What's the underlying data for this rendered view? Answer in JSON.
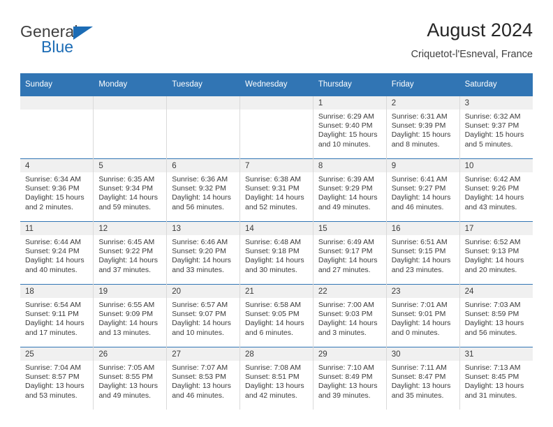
{
  "brand": {
    "word_top": "General",
    "word_bottom": "Blue",
    "accent_color": "#1c6cb5"
  },
  "header": {
    "title": "August 2024",
    "subtitle": "Criquetot-l'Esneval, France"
  },
  "theme": {
    "header_blue": "#3175B4",
    "daynum_gray": "#f0f0f0",
    "text": "#3a3a3a"
  },
  "calendar": {
    "weekday_headers": [
      "Sunday",
      "Monday",
      "Tuesday",
      "Wednesday",
      "Thursday",
      "Friday",
      "Saturday"
    ],
    "labels": {
      "sunrise": "Sunrise:",
      "sunset": "Sunset:",
      "daylight": "Daylight:"
    },
    "weeks": [
      [
        {
          "day": "",
          "blank": true
        },
        {
          "day": "",
          "blank": true
        },
        {
          "day": "",
          "blank": true
        },
        {
          "day": "",
          "blank": true
        },
        {
          "day": "1",
          "sunrise": "Sunrise: 6:29 AM",
          "sunset": "Sunset: 9:40 PM",
          "daylight1": "Daylight: 15 hours",
          "daylight2": "and 10 minutes."
        },
        {
          "day": "2",
          "sunrise": "Sunrise: 6:31 AM",
          "sunset": "Sunset: 9:39 PM",
          "daylight1": "Daylight: 15 hours",
          "daylight2": "and 8 minutes."
        },
        {
          "day": "3",
          "sunrise": "Sunrise: 6:32 AM",
          "sunset": "Sunset: 9:37 PM",
          "daylight1": "Daylight: 15 hours",
          "daylight2": "and 5 minutes."
        }
      ],
      [
        {
          "day": "4",
          "sunrise": "Sunrise: 6:34 AM",
          "sunset": "Sunset: 9:36 PM",
          "daylight1": "Daylight: 15 hours",
          "daylight2": "and 2 minutes."
        },
        {
          "day": "5",
          "sunrise": "Sunrise: 6:35 AM",
          "sunset": "Sunset: 9:34 PM",
          "daylight1": "Daylight: 14 hours",
          "daylight2": "and 59 minutes."
        },
        {
          "day": "6",
          "sunrise": "Sunrise: 6:36 AM",
          "sunset": "Sunset: 9:32 PM",
          "daylight1": "Daylight: 14 hours",
          "daylight2": "and 56 minutes."
        },
        {
          "day": "7",
          "sunrise": "Sunrise: 6:38 AM",
          "sunset": "Sunset: 9:31 PM",
          "daylight1": "Daylight: 14 hours",
          "daylight2": "and 52 minutes."
        },
        {
          "day": "8",
          "sunrise": "Sunrise: 6:39 AM",
          "sunset": "Sunset: 9:29 PM",
          "daylight1": "Daylight: 14 hours",
          "daylight2": "and 49 minutes."
        },
        {
          "day": "9",
          "sunrise": "Sunrise: 6:41 AM",
          "sunset": "Sunset: 9:27 PM",
          "daylight1": "Daylight: 14 hours",
          "daylight2": "and 46 minutes."
        },
        {
          "day": "10",
          "sunrise": "Sunrise: 6:42 AM",
          "sunset": "Sunset: 9:26 PM",
          "daylight1": "Daylight: 14 hours",
          "daylight2": "and 43 minutes."
        }
      ],
      [
        {
          "day": "11",
          "sunrise": "Sunrise: 6:44 AM",
          "sunset": "Sunset: 9:24 PM",
          "daylight1": "Daylight: 14 hours",
          "daylight2": "and 40 minutes."
        },
        {
          "day": "12",
          "sunrise": "Sunrise: 6:45 AM",
          "sunset": "Sunset: 9:22 PM",
          "daylight1": "Daylight: 14 hours",
          "daylight2": "and 37 minutes."
        },
        {
          "day": "13",
          "sunrise": "Sunrise: 6:46 AM",
          "sunset": "Sunset: 9:20 PM",
          "daylight1": "Daylight: 14 hours",
          "daylight2": "and 33 minutes."
        },
        {
          "day": "14",
          "sunrise": "Sunrise: 6:48 AM",
          "sunset": "Sunset: 9:18 PM",
          "daylight1": "Daylight: 14 hours",
          "daylight2": "and 30 minutes."
        },
        {
          "day": "15",
          "sunrise": "Sunrise: 6:49 AM",
          "sunset": "Sunset: 9:17 PM",
          "daylight1": "Daylight: 14 hours",
          "daylight2": "and 27 minutes."
        },
        {
          "day": "16",
          "sunrise": "Sunrise: 6:51 AM",
          "sunset": "Sunset: 9:15 PM",
          "daylight1": "Daylight: 14 hours",
          "daylight2": "and 23 minutes."
        },
        {
          "day": "17",
          "sunrise": "Sunrise: 6:52 AM",
          "sunset": "Sunset: 9:13 PM",
          "daylight1": "Daylight: 14 hours",
          "daylight2": "and 20 minutes."
        }
      ],
      [
        {
          "day": "18",
          "sunrise": "Sunrise: 6:54 AM",
          "sunset": "Sunset: 9:11 PM",
          "daylight1": "Daylight: 14 hours",
          "daylight2": "and 17 minutes."
        },
        {
          "day": "19",
          "sunrise": "Sunrise: 6:55 AM",
          "sunset": "Sunset: 9:09 PM",
          "daylight1": "Daylight: 14 hours",
          "daylight2": "and 13 minutes."
        },
        {
          "day": "20",
          "sunrise": "Sunrise: 6:57 AM",
          "sunset": "Sunset: 9:07 PM",
          "daylight1": "Daylight: 14 hours",
          "daylight2": "and 10 minutes."
        },
        {
          "day": "21",
          "sunrise": "Sunrise: 6:58 AM",
          "sunset": "Sunset: 9:05 PM",
          "daylight1": "Daylight: 14 hours",
          "daylight2": "and 6 minutes."
        },
        {
          "day": "22",
          "sunrise": "Sunrise: 7:00 AM",
          "sunset": "Sunset: 9:03 PM",
          "daylight1": "Daylight: 14 hours",
          "daylight2": "and 3 minutes."
        },
        {
          "day": "23",
          "sunrise": "Sunrise: 7:01 AM",
          "sunset": "Sunset: 9:01 PM",
          "daylight1": "Daylight: 14 hours",
          "daylight2": "and 0 minutes."
        },
        {
          "day": "24",
          "sunrise": "Sunrise: 7:03 AM",
          "sunset": "Sunset: 8:59 PM",
          "daylight1": "Daylight: 13 hours",
          "daylight2": "and 56 minutes."
        }
      ],
      [
        {
          "day": "25",
          "sunrise": "Sunrise: 7:04 AM",
          "sunset": "Sunset: 8:57 PM",
          "daylight1": "Daylight: 13 hours",
          "daylight2": "and 53 minutes."
        },
        {
          "day": "26",
          "sunrise": "Sunrise: 7:05 AM",
          "sunset": "Sunset: 8:55 PM",
          "daylight1": "Daylight: 13 hours",
          "daylight2": "and 49 minutes."
        },
        {
          "day": "27",
          "sunrise": "Sunrise: 7:07 AM",
          "sunset": "Sunset: 8:53 PM",
          "daylight1": "Daylight: 13 hours",
          "daylight2": "and 46 minutes."
        },
        {
          "day": "28",
          "sunrise": "Sunrise: 7:08 AM",
          "sunset": "Sunset: 8:51 PM",
          "daylight1": "Daylight: 13 hours",
          "daylight2": "and 42 minutes."
        },
        {
          "day": "29",
          "sunrise": "Sunrise: 7:10 AM",
          "sunset": "Sunset: 8:49 PM",
          "daylight1": "Daylight: 13 hours",
          "daylight2": "and 39 minutes."
        },
        {
          "day": "30",
          "sunrise": "Sunrise: 7:11 AM",
          "sunset": "Sunset: 8:47 PM",
          "daylight1": "Daylight: 13 hours",
          "daylight2": "and 35 minutes."
        },
        {
          "day": "31",
          "sunrise": "Sunrise: 7:13 AM",
          "sunset": "Sunset: 8:45 PM",
          "daylight1": "Daylight: 13 hours",
          "daylight2": "and 31 minutes."
        }
      ]
    ]
  }
}
